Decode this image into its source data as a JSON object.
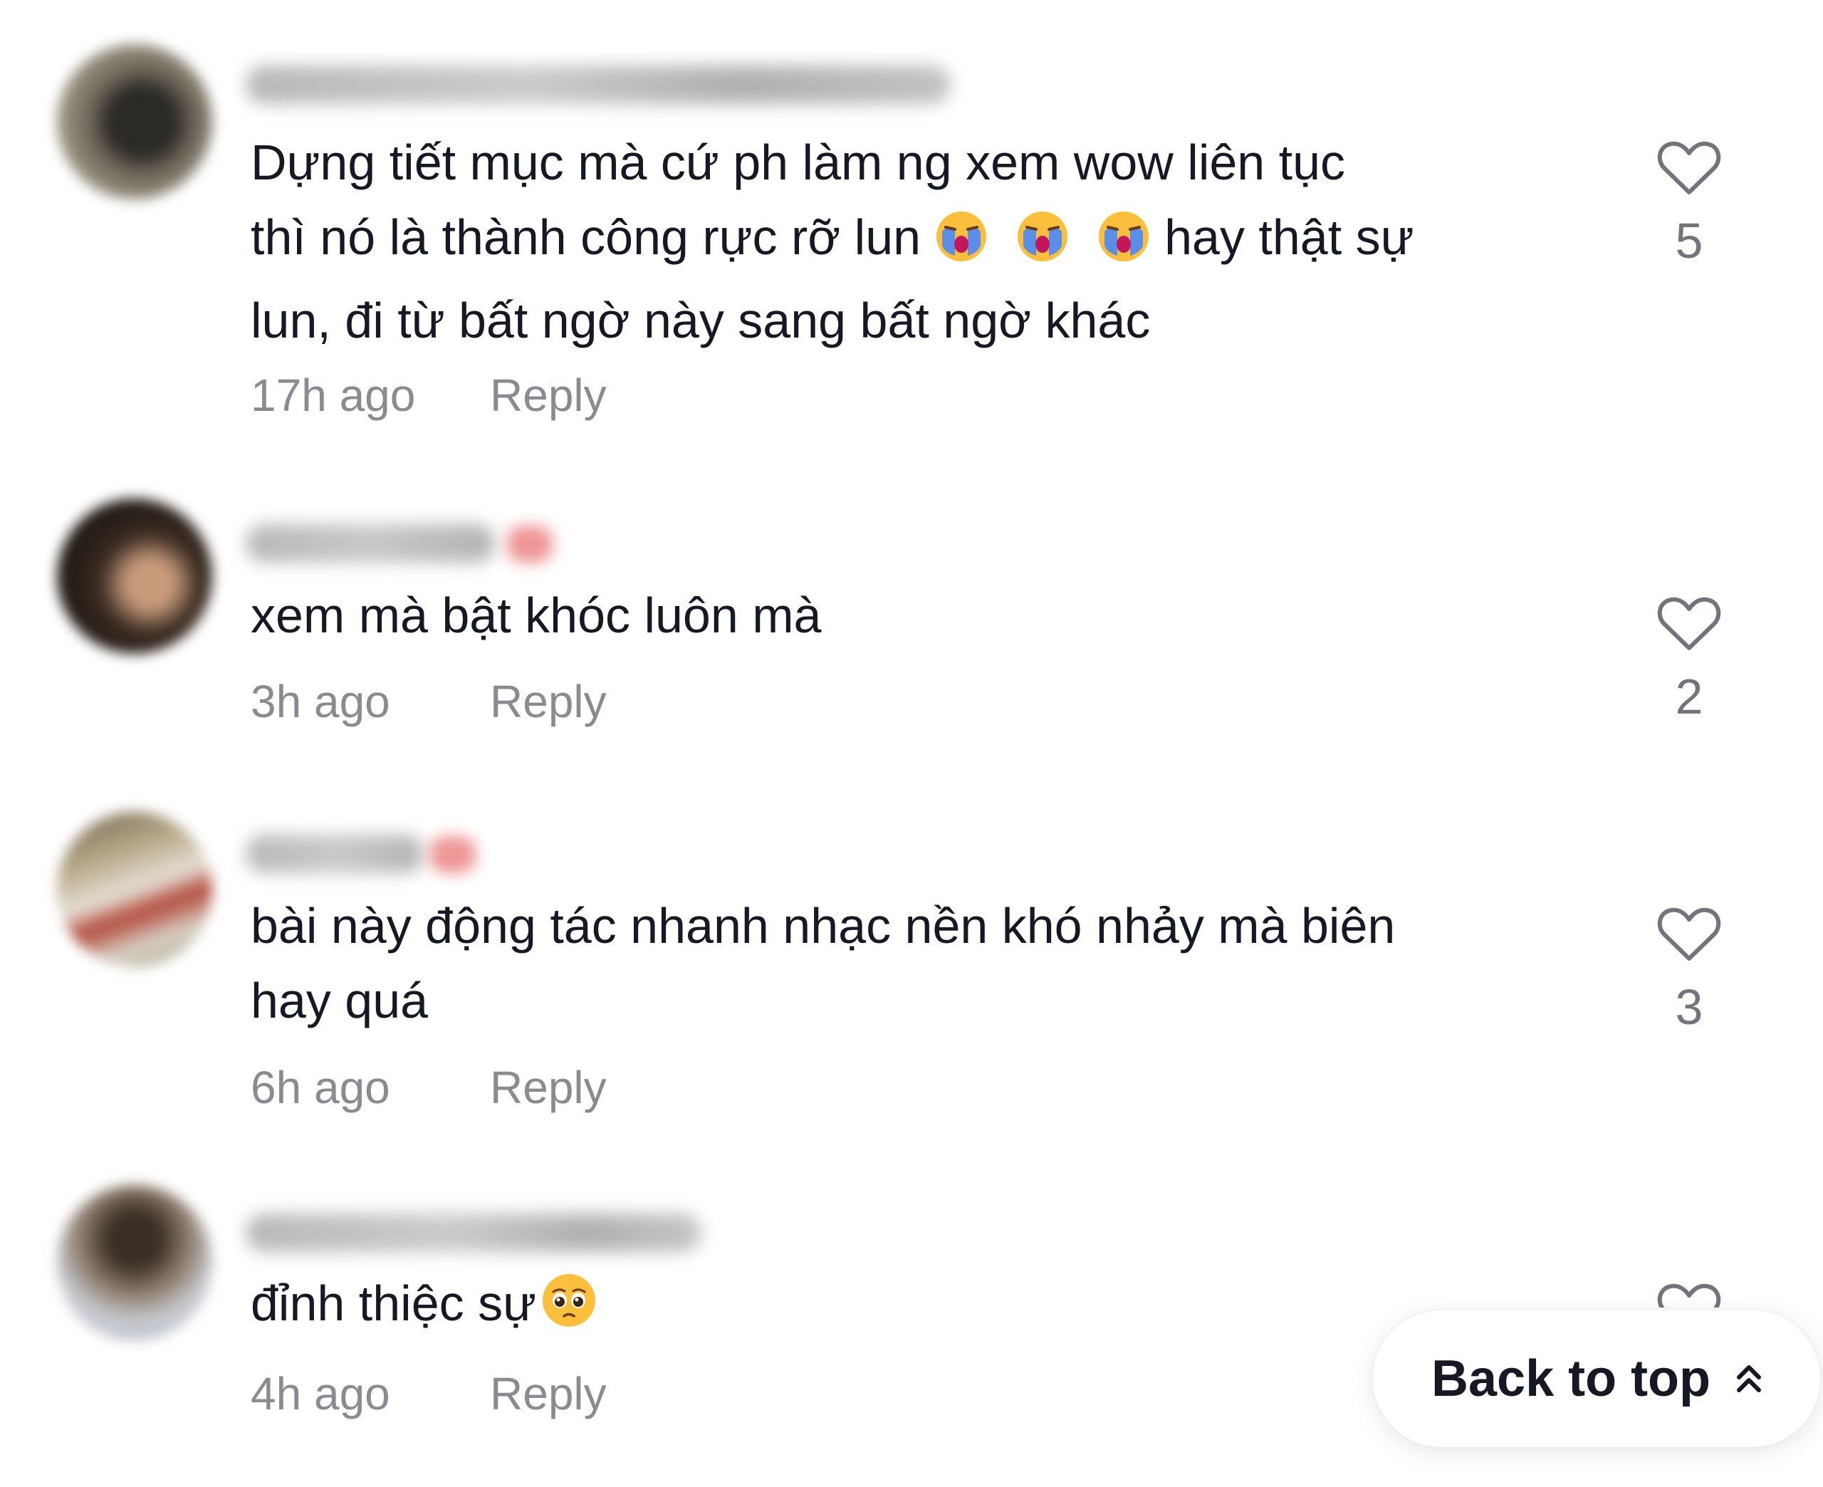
{
  "comments": [
    {
      "text_parts": [
        "Dựng tiết mục mà cứ ph làm ng xem wow liên tục\nthì nó là thành công rực rỡ lun",
        "hay thật sự\nlun, đi từ bất ngờ này sang bất ngờ khác"
      ],
      "emojis": [
        "loudly-crying-face",
        "loudly-crying-face",
        "loudly-crying-face"
      ],
      "time": "17h ago",
      "reply": "Reply",
      "likes": "5"
    },
    {
      "text": "xem mà bật khóc luôn mà",
      "time": "3h ago",
      "reply": "Reply",
      "likes": "2"
    },
    {
      "text": "bài này động tác nhanh nhạc nền khó nhảy mà biên\nhay quá",
      "time": "6h ago",
      "reply": "Reply",
      "likes": "3"
    },
    {
      "text": "đỉnh thiệc sự",
      "emojis": [
        "pleading-face"
      ],
      "time": "4h ago",
      "reply": "Reply"
    }
  ],
  "back_to_top": {
    "label": "Back to top",
    "icon": "double-chevron-up-icon"
  },
  "icons": {
    "like": "heart-outline-icon"
  },
  "colors": {
    "text": "#161823",
    "meta": "#8a8b91",
    "like_count": "#73747b",
    "icon": "#73747b"
  }
}
